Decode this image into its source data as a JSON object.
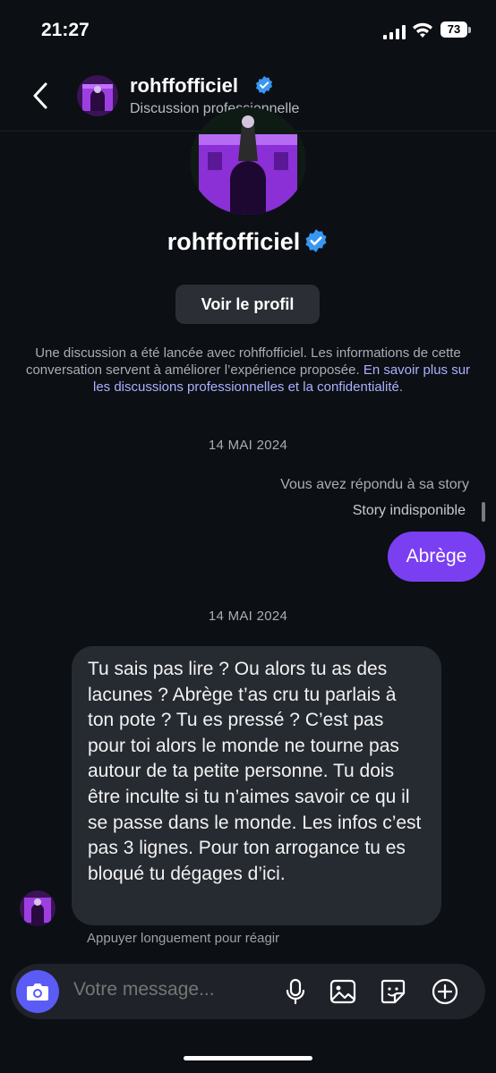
{
  "status_bar": {
    "time": "21:27",
    "battery": "73"
  },
  "header": {
    "username": "rohffofficiel",
    "subtitle": "Discussion professionnelle"
  },
  "profile": {
    "name": "rohffofficiel",
    "view_profile_label": "Voir le profil"
  },
  "info": {
    "text": "Une discussion a été lancée avec rohffofficiel. Les informations de cette conversation servent à améliorer l’expérience proposée. ",
    "link": "En savoir plus sur les discussions professionnelles et la confidentialité",
    "end": "."
  },
  "messages": {
    "date_1": "14 MAI 2024",
    "story_reply_label": "Vous avez répondu à sa story",
    "story_unavailable": "Story indisponible",
    "outgoing": "Abrège",
    "date_2": "14 MAI 2024",
    "incoming": "Tu sais pas lire ? Ou alors tu as des lacunes ? Abrège t’as cru tu parlais à ton pote ? Tu es pressé ? C’est pas pour toi alors le monde ne tourne pas autour de ta petite personne.  Tu dois être inculte si tu n’aimes savoir ce qu il se passe dans le monde. Les infos c’est pas 3 lignes. Pour ton arrogance tu es bloqué tu dégages d’ici.",
    "react_hint": "Appuyer longuement pour réagir"
  },
  "composer": {
    "placeholder": "Votre message..."
  },
  "icons": [
    "back-icon",
    "verified-icon",
    "camera-icon",
    "microphone-icon",
    "gallery-icon",
    "sticker-icon",
    "plus-icon"
  ],
  "colors": {
    "accent": "#7b3ff2",
    "verified": "#3897f0",
    "link": "#a9b2ff",
    "camera": "#5b5bf5"
  }
}
